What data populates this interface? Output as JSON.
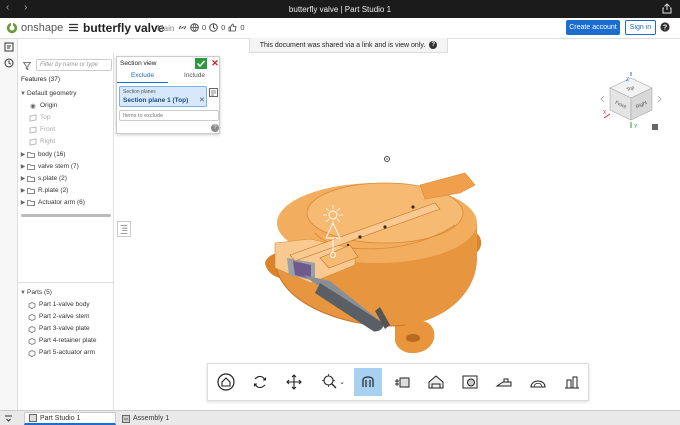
{
  "window": {
    "title": "butterfly valve | Part Studio 1",
    "nav": "‹ ›"
  },
  "header": {
    "brand": "onshape",
    "document_title": "butterfly valve",
    "branch": "Main",
    "views_count": "0",
    "copies_count": "0",
    "likes_count": "0",
    "create_account_label": "Create account",
    "sign_in_label": "Sign in"
  },
  "banner": {
    "text": "This document was shared via a link and is view only."
  },
  "sidebar": {
    "filter_placeholder": "Filter by name or type",
    "features_header": "Features (37)",
    "default_geometry": "Default geometry",
    "geometry_items": [
      "Origin",
      "Top",
      "Front",
      "Right"
    ],
    "features": [
      "body (16)",
      "valve stem (7)",
      "s.plate (2)",
      "R.plate (2)",
      "Actuator arm (6)"
    ],
    "parts_header": "Parts (5)",
    "parts": [
      "Part 1-valve body",
      "Part 2-valve stem",
      "Part 3-valve plate",
      "Part 4-retainer plate",
      "Part 5-actuator arm"
    ]
  },
  "section_panel": {
    "title": "Section view",
    "tab_exclude": "Exclude",
    "tab_include": "Include",
    "planes_label": "Section planes",
    "planes_value": "Section plane 1 (Top)",
    "exclude_placeholder": "Items to exclude"
  },
  "viewcube": {
    "top": "Top",
    "front": "Front",
    "right": "Right",
    "axis_x": "X",
    "axis_y": "Y",
    "axis_z": "Z"
  },
  "toolbar": {
    "tools": [
      "home-view",
      "rotate",
      "pan",
      "zoom",
      "section-view",
      "explode",
      "measure",
      "render",
      "appearance",
      "display-mode",
      "named-views"
    ]
  },
  "bottom_tabs": {
    "part_studio": "Part Studio 1",
    "assembly": "Assembly 1"
  },
  "colors": {
    "accent": "#1c6dd0",
    "model_orange": "#f0a04b",
    "model_inner": "#f8c991",
    "section_gray": "#8a8f96",
    "ok_green": "#2c9a3a"
  }
}
